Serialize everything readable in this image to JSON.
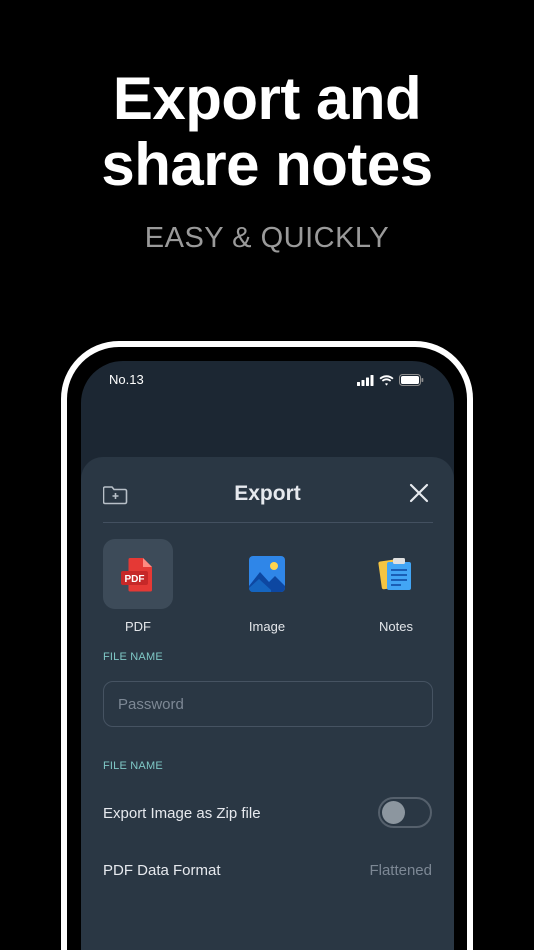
{
  "hero": {
    "line1": "Export and",
    "line2": "share notes",
    "subtitle": "EASY & QUICKLY"
  },
  "status_bar": {
    "time": "No.13",
    "icons": [
      "signal-icon",
      "wifi-icon",
      "battery-icon"
    ]
  },
  "sheet": {
    "title": "Export",
    "left_icon": "folder-plus-icon",
    "right_icon": "close-icon",
    "formats": [
      {
        "label": "PDF",
        "icon": "pdf-icon",
        "badge": "PDF",
        "selected": true
      },
      {
        "label": "Image",
        "icon": "image-icon",
        "selected": false
      },
      {
        "label": "Notes",
        "icon": "notes-icon",
        "selected": false
      }
    ],
    "file_name_label": "FILE NAME",
    "file_name_placeholder": "Password",
    "options_label": "FILE NAME",
    "zip_option": {
      "label": "Export Image as Zip file",
      "enabled": false
    },
    "pdf_format": {
      "label": "PDF Data Format",
      "value": "Flattened"
    }
  },
  "colors": {
    "background": "#000000",
    "screen": "#1c2733",
    "sheet": "#2a3744",
    "accent_label": "#7fc8c6",
    "pdf_red": "#e53935",
    "image_blue": "#2f86e8",
    "notes_yellow": "#f5c542"
  }
}
